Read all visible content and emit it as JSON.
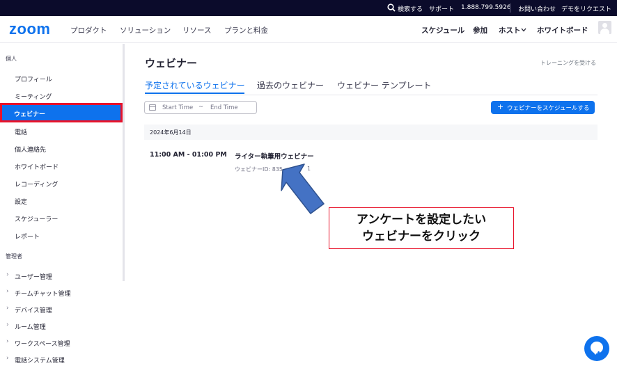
{
  "topbar": {
    "search_label": "検索する",
    "support_label": "サポート",
    "phone": "1.888.799.5926",
    "contact_label": "お問い合わせ",
    "demo_label": "デモをリクエスト"
  },
  "header": {
    "logo": "zoom",
    "nav_left": [
      "プロダクト",
      "ソリューション",
      "リソース",
      "プランと料金"
    ],
    "nav_right": [
      "スケジュール",
      "参加",
      "ホスト",
      "ホワイトボード"
    ],
    "host_chevron_icon": "chevron-down-icon"
  },
  "sidebar": {
    "personal_section": "個人",
    "personal_items": [
      "プロフィール",
      "ミーティング",
      "ウェビナー",
      "電話",
      "個人連絡先",
      "ホワイトボード",
      "レコーディング",
      "設定",
      "スケジューラー",
      "レポート"
    ],
    "active_item": "ウェビナー",
    "admin_section": "管理者",
    "admin_items": [
      "ユーザー管理",
      "チームチャット管理",
      "デバイス管理",
      "ルーム管理",
      "ワークスペース管理",
      "電話システム管理"
    ]
  },
  "main": {
    "title": "ウェビナー",
    "training_link": "トレーニングを受ける",
    "tabs": [
      {
        "label": "予定されているウェビナー",
        "active": true
      },
      {
        "label": "過去のウェビナー",
        "active": false
      },
      {
        "label": "ウェビナー テンプレート",
        "active": false
      }
    ],
    "date_range": {
      "start_placeholder": "Start Time",
      "separator": "~",
      "end_placeholder": "End Time"
    },
    "schedule_button": "ウェビナーをスケジュールする",
    "schedule_button_icon": "+",
    "date_group": "2024年6月14日",
    "webinar": {
      "time": "11:00 AM - 01:00 PM",
      "title": "ライター執筆用ウェビナー",
      "id_label": "ウェビナーID: 835",
      "id_tail": "1"
    }
  },
  "annotation": {
    "callout_line1": "アンケートを設定したい",
    "callout_line2": "ウェビナーをクリック",
    "arrow_color": "#4472c4",
    "highlight_color": "#e8122a"
  },
  "colors": {
    "brand": "#0e72ed",
    "topbar": "#0b0b2b"
  }
}
